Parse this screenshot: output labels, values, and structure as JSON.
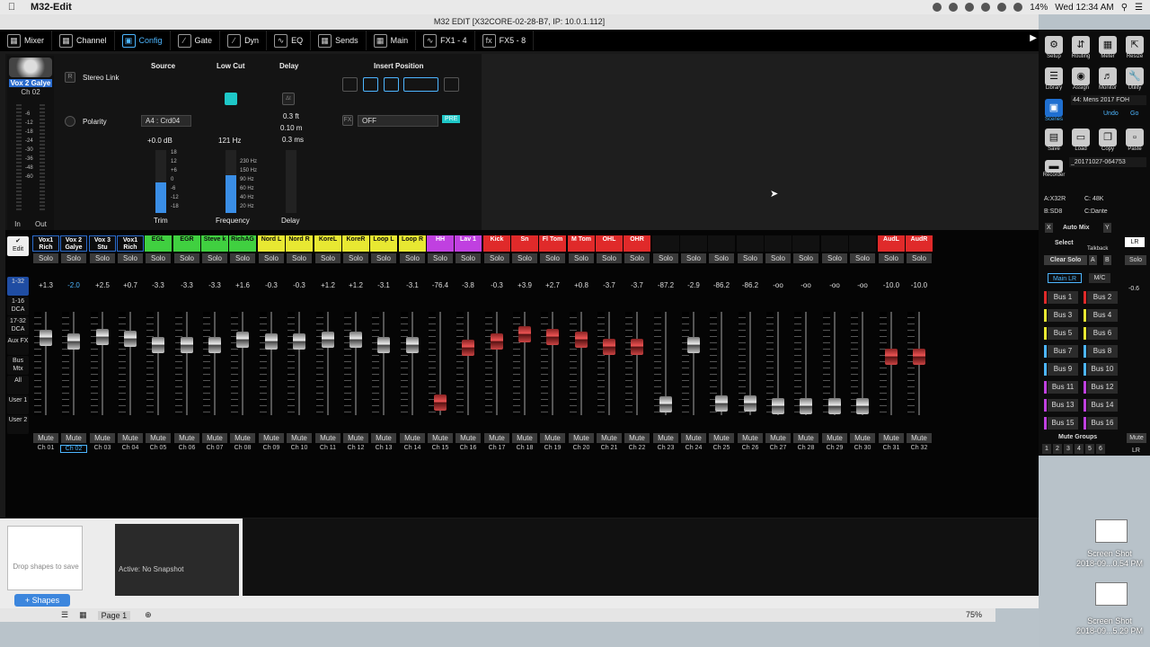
{
  "app": {
    "name": "M32-Edit",
    "window_title": "M32 EDIT [X32CORE-02-28-B7, IP: 10.0.1.112]"
  },
  "menubar": {
    "battery": "14%",
    "datetime": "Wed 12:34 AM"
  },
  "tabs": [
    {
      "label": "Mixer",
      "icon": "mixer-icon"
    },
    {
      "label": "Channel",
      "icon": "channel-icon"
    },
    {
      "label": "Config",
      "icon": "config-icon"
    },
    {
      "label": "Gate",
      "icon": "gate-icon"
    },
    {
      "label": "Dyn",
      "icon": "dyn-icon"
    },
    {
      "label": "EQ",
      "icon": "eq-icon"
    },
    {
      "label": "Sends",
      "icon": "sends-icon"
    },
    {
      "label": "Main",
      "icon": "main-icon"
    },
    {
      "label": "FX1 - 4",
      "icon": "fx-icon"
    },
    {
      "label": "FX5 - 8",
      "icon": "fx-icon"
    }
  ],
  "selected_channel": {
    "name": "Vox 2 Galye",
    "number": "Ch 02",
    "in": "In",
    "out": "Out"
  },
  "config": {
    "source_title": "Source",
    "lowcut_title": "Low Cut",
    "delay_title": "Delay",
    "insert_title": "Insert Position",
    "stereo_link": "Stereo Link",
    "polarity": "Polarity",
    "source_value": "A4 : Crd04",
    "trim_value": "+0.0 dB",
    "trim_label": "Trim",
    "lowcut_value": "121 Hz",
    "frequency_label": "Frequency",
    "delay_ft": "0.3 ft",
    "delay_m": "0.10 m",
    "delay_ms": "0.3 ms",
    "delay_label": "Delay",
    "insert_value": "OFF",
    "pre": "PRE",
    "trim_scale": [
      "18",
      "12",
      "+6",
      "0",
      "-6",
      "-12",
      "-18"
    ],
    "freq_scale": [
      "230 Hz",
      "150 Hz",
      "90 Hz",
      "60 Hz",
      "40 Hz",
      "20 Hz"
    ]
  },
  "leftnav": [
    "1-32",
    "1-16 DCA",
    "17-32 DCA",
    "Aux FX",
    "Bus Mtx",
    "All",
    "User 1",
    "User 2"
  ],
  "edit_label": "Edit",
  "solo_label": "Solo",
  "mute_label": "Mute",
  "channels": [
    {
      "name": "Vox1 Rich",
      "color": "#7fb8ff",
      "gain": "+1.3",
      "fader": 0.74
    },
    {
      "name": "Vox 2 Galye",
      "color": "#7fb8ff",
      "gain": "-2.0",
      "fader": 0.7
    },
    {
      "name": "Vox 3 Stu",
      "color": "#7fb8ff",
      "gain": "+2.5",
      "fader": 0.75
    },
    {
      "name": "Vox1 Rich",
      "color": "#7fb8ff",
      "gain": "+0.7",
      "fader": 0.73
    },
    {
      "name": "EGL",
      "color": "#40d040",
      "gain": "-3.3",
      "fader": 0.66
    },
    {
      "name": "EGR",
      "color": "#40d040",
      "gain": "-3.3",
      "fader": 0.66
    },
    {
      "name": "Steve k",
      "color": "#40d040",
      "gain": "-3.3",
      "fader": 0.66
    },
    {
      "name": "RichAG",
      "color": "#40d040",
      "gain": "+1.6",
      "fader": 0.72
    },
    {
      "name": "Nord L",
      "color": "#e8e832",
      "gain": "-0.3",
      "fader": 0.7
    },
    {
      "name": "Nord R",
      "color": "#e8e832",
      "gain": "-0.3",
      "fader": 0.7
    },
    {
      "name": "KoreL",
      "color": "#e8e832",
      "gain": "+1.2",
      "fader": 0.72
    },
    {
      "name": "KoreR",
      "color": "#e8e832",
      "gain": "+1.2",
      "fader": 0.72
    },
    {
      "name": "Loop L",
      "color": "#e8e832",
      "gain": "-3.1",
      "fader": 0.66
    },
    {
      "name": "Loop R",
      "color": "#e8e832",
      "gain": "-3.1",
      "fader": 0.66
    },
    {
      "name": "HH",
      "color": "#c040e0",
      "gain": "-76.4",
      "fader": 0.08
    },
    {
      "name": "Lav 1",
      "color": "#c040e0",
      "gain": "-3.8",
      "fader": 0.64
    },
    {
      "name": "Kick",
      "color": "#e02a2a",
      "gain": "-0.3",
      "fader": 0.7
    },
    {
      "name": "Sn",
      "color": "#e02a2a",
      "gain": "+3.9",
      "fader": 0.77
    },
    {
      "name": "Fl Tom",
      "color": "#e02a2a",
      "gain": "+2.7",
      "fader": 0.75
    },
    {
      "name": "M Tom",
      "color": "#e02a2a",
      "gain": "+0.8",
      "fader": 0.72
    },
    {
      "name": "OHL",
      "color": "#e02a2a",
      "gain": "-3.7",
      "fader": 0.65
    },
    {
      "name": "OHR",
      "color": "#e02a2a",
      "gain": "-3.7",
      "fader": 0.65
    },
    {
      "name": "",
      "color": "#111",
      "gain": "-87.2",
      "fader": 0.06
    },
    {
      "name": "",
      "color": "#111",
      "gain": "-2.9",
      "fader": 0.66
    },
    {
      "name": "",
      "color": "#111",
      "gain": "-86.2",
      "fader": 0.07
    },
    {
      "name": "",
      "color": "#111",
      "gain": "-86.2",
      "fader": 0.07
    },
    {
      "name": "",
      "color": "#111",
      "gain": "-oo",
      "fader": 0.05
    },
    {
      "name": "",
      "color": "#111",
      "gain": "-oo",
      "fader": 0.05
    },
    {
      "name": "",
      "color": "#111",
      "gain": "-oo",
      "fader": 0.05
    },
    {
      "name": "",
      "color": "#111",
      "gain": "-oo",
      "fader": 0.05
    },
    {
      "name": "AudL",
      "color": "#e02a2a",
      "gain": "-10.0",
      "fader": 0.55
    },
    {
      "name": "AudR",
      "color": "#e02a2a",
      "gain": "-10.0",
      "fader": 0.55
    }
  ],
  "channel_labels": [
    "Ch 01",
    "Ch 02",
    "Ch 03",
    "Ch 04",
    "Ch 05",
    "Ch 06",
    "Ch 07",
    "Ch 08",
    "Ch 09",
    "Ch 10",
    "Ch 11",
    "Ch 12",
    "Ch 13",
    "Ch 14",
    "Ch 15",
    "Ch 16",
    "Ch 17",
    "Ch 18",
    "Ch 19",
    "Ch 20",
    "Ch 21",
    "Ch 22",
    "Ch 23",
    "Ch 24",
    "Ch 25",
    "Ch 26",
    "Ch 27",
    "Ch 28",
    "Ch 29",
    "Ch 30",
    "Ch 31",
    "Ch 32"
  ],
  "right": {
    "setup": "Setup",
    "routing": "Routing",
    "meter": "Meter",
    "resize": "Resize",
    "library": "Library",
    "assign": "Assign",
    "monitor": "Monitor",
    "utility": "Utility",
    "scenes": "Scenes",
    "scene_name": "44: Mens 2017 FOH",
    "undo": "Undo",
    "go": "Go",
    "save": "Save",
    "load": "Load",
    "copy": "Copy",
    "paste": "Paste",
    "scene_file": "_20171027-064753",
    "recorder": "Recorder",
    "a": "A:X32R",
    "c": "C: 48K",
    "b": "B:SD8",
    "cd": "C:Dante",
    "automix": "Auto Mix",
    "x": "X",
    "y": "Y",
    "select": "Select",
    "talkback": "Talkback",
    "lr": "LR",
    "clear_solo": "Clear Solo",
    "ta": "A",
    "tb": "B",
    "solo": "Solo",
    "mainlr": "Main LR",
    "mc": "M/C",
    "main_gain": "-0.6",
    "buses": [
      "Bus 1",
      "Bus 2",
      "Bus 3",
      "Bus 4",
      "Bus 5",
      "Bus 6",
      "Bus 7",
      "Bus 8",
      "Bus 9",
      "Bus 10",
      "Bus 11",
      "Bus 12",
      "Bus 13",
      "Bus 14",
      "Bus 15",
      "Bus 16"
    ],
    "mute_groups": "Mute Groups",
    "groups": [
      "1",
      "2",
      "3",
      "4",
      "5",
      "6"
    ],
    "mute": "Mute",
    "lr2": "LR"
  },
  "lower": {
    "drop": "Drop shapes to save",
    "shapes_btn": "+ Shapes",
    "snapshot": "Active: No Snapshot",
    "page": "Page 1",
    "zoom": "75%"
  },
  "desktop": {
    "shot1": "Screen Shot",
    "shot1_date": "2018-09...0.54 PM",
    "shot2": "Screen Shot",
    "shot2_date": "2018-09...5.29 PM"
  }
}
